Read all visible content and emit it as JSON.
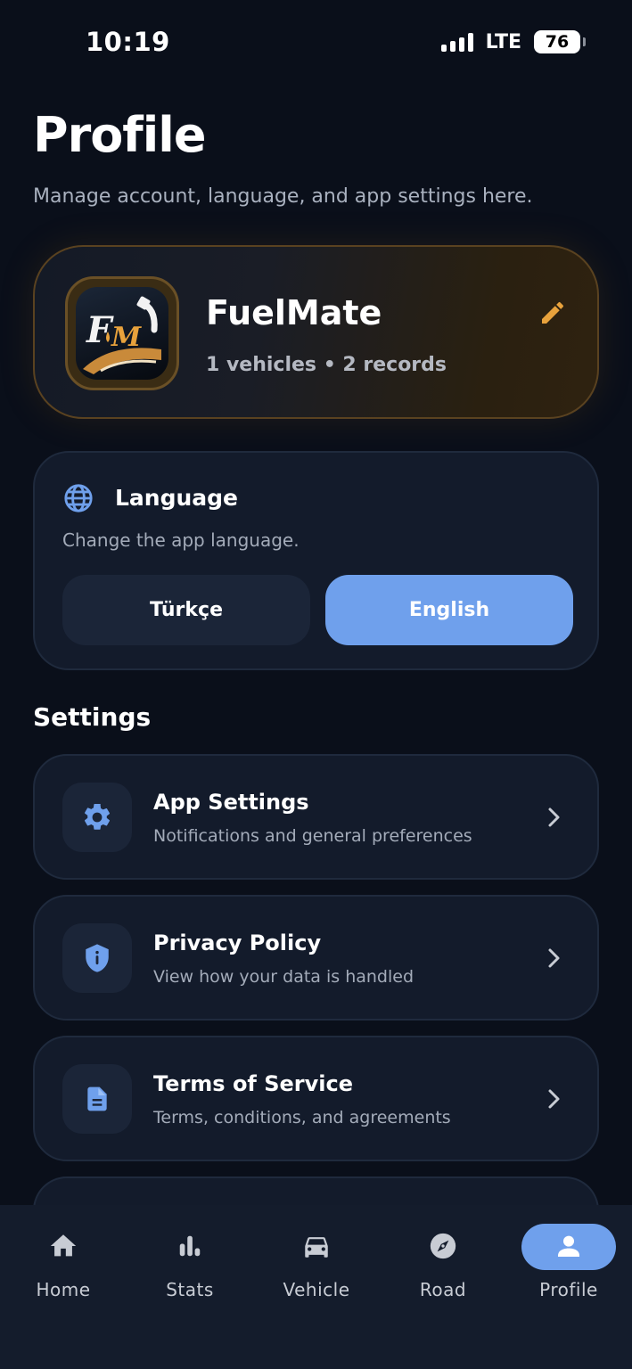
{
  "status_bar": {
    "time": "10:19",
    "network": "LTE",
    "battery": "76"
  },
  "header": {
    "title": "Profile",
    "subtitle": "Manage account, language, and app settings here."
  },
  "profile": {
    "name": "FuelMate",
    "meta": "1 vehicles • 2 records",
    "logo_text": "FM",
    "accent_color": "#e8a23c"
  },
  "language": {
    "title": "Language",
    "description": "Change the app language.",
    "options": [
      {
        "label": "Türkçe",
        "selected": false
      },
      {
        "label": "English",
        "selected": true
      }
    ]
  },
  "settings": {
    "section_title": "Settings",
    "items": [
      {
        "title": "App Settings",
        "description": "Notifications and general preferences",
        "icon": "gear-icon"
      },
      {
        "title": "Privacy Policy",
        "description": "View how your data is handled",
        "icon": "shield-icon"
      },
      {
        "title": "Terms of Service",
        "description": "Terms, conditions, and agreements",
        "icon": "document-icon"
      }
    ]
  },
  "nav": {
    "items": [
      {
        "label": "Home",
        "icon": "home-icon",
        "active": false
      },
      {
        "label": "Stats",
        "icon": "stats-icon",
        "active": false
      },
      {
        "label": "Vehicle",
        "icon": "car-icon",
        "active": false
      },
      {
        "label": "Road",
        "icon": "compass-icon",
        "active": false
      },
      {
        "label": "Profile",
        "icon": "person-icon",
        "active": true
      }
    ]
  },
  "colors": {
    "background": "#0a0f1a",
    "card": "#131b2b",
    "primary": "#6fa0ec",
    "icon_blue": "#6fa0ec"
  }
}
